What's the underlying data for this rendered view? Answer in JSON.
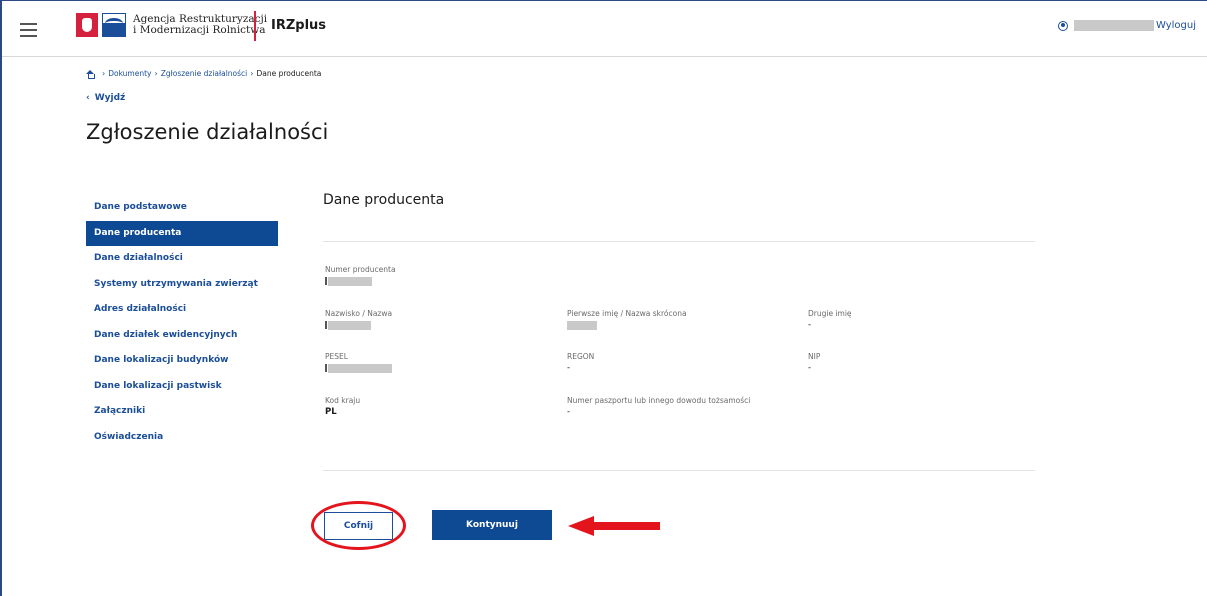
{
  "header": {
    "agency_line1": "Agencja Restrukturyzacji",
    "agency_line2": "i Modernizacji Rolnictwa",
    "app_name": "IRZplus",
    "logout_label": "Wyloguj"
  },
  "breadcrumb": {
    "items": [
      "Dokumenty",
      "Zgłoszenie działalności"
    ],
    "current": "Dane producenta"
  },
  "back_label": "Wyjdź",
  "page_title": "Zgłoszenie działalności",
  "sidenav": {
    "items": [
      {
        "label": "Dane podstawowe",
        "active": false
      },
      {
        "label": "Dane producenta",
        "active": true
      },
      {
        "label": "Dane działalności",
        "active": false
      },
      {
        "label": "Systemy utrzymywania zwierząt",
        "active": false
      },
      {
        "label": "Adres działalności",
        "active": false
      },
      {
        "label": "Dane działek ewidencyjnych",
        "active": false
      },
      {
        "label": "Dane lokalizacji budynków",
        "active": false
      },
      {
        "label": "Dane lokalizacji pastwisk",
        "active": false
      },
      {
        "label": "Załączniki",
        "active": false
      },
      {
        "label": "Oświadczenia",
        "active": false
      }
    ]
  },
  "section": {
    "title": "Dane producenta",
    "fields": {
      "producer_number": {
        "label": "Numer producenta",
        "value": ""
      },
      "surname": {
        "label": "Nazwisko / Nazwa",
        "value": ""
      },
      "first_name": {
        "label": "Pierwsze imię / Nazwa skrócona",
        "value": ""
      },
      "second_name": {
        "label": "Drugie imię",
        "value": "-"
      },
      "pesel": {
        "label": "PESEL",
        "value": ""
      },
      "regon": {
        "label": "REGON",
        "value": "-"
      },
      "nip": {
        "label": "NIP",
        "value": "-"
      },
      "country_code": {
        "label": "Kod kraju",
        "value": "PL"
      },
      "passport": {
        "label": "Numer paszportu lub innego dowodu tożsamości",
        "value": "-"
      }
    }
  },
  "buttons": {
    "back": "Cofnij",
    "continue": "Kontynuuj"
  },
  "colors": {
    "primary": "#0e4a94",
    "link": "#1b4e99",
    "annotation": "#e3141b"
  }
}
